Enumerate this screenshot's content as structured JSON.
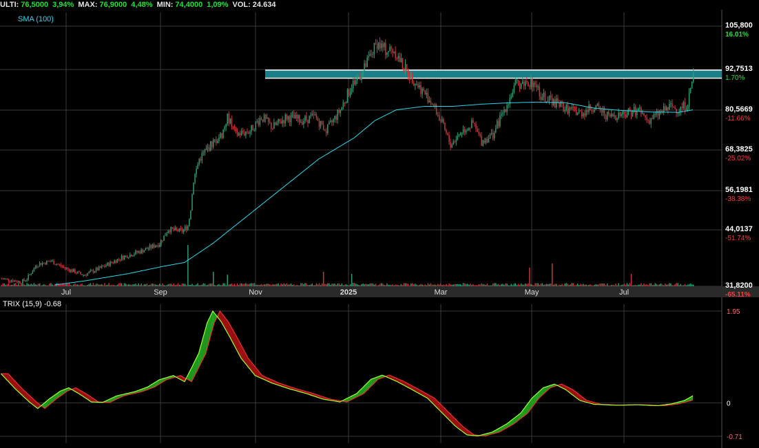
{
  "header": {
    "ulti_label": "ULTI:",
    "ulti_value": "76,5000",
    "ulti_pct": "3,94%",
    "max_label": "MAX:",
    "max_value": "76,9000",
    "max_pct": "4,48%",
    "min_label": "MIN:",
    "min_value": "74,4000",
    "min_pct": "1,09%",
    "vol_label": "VOL:",
    "vol_value": "24.634"
  },
  "sma_label": "SMA (100)",
  "trix_label": "TRIX (15,9) -0.68",
  "colors": {
    "up": "#2f9a73",
    "down": "#c8343f",
    "sma": "#2fd9e8",
    "band": "#1a7f86",
    "trix_fast": "#9cff3c",
    "trix_slow": "#e83030",
    "grid": "#3a3a3a",
    "pct_pos": "#22e03a",
    "pct_neg": "#ff3b3b"
  },
  "chart_data": [
    {
      "type": "candlestick",
      "x_labels": [
        "Jul",
        "Sep",
        "Nov",
        "2025",
        "Mar",
        "May",
        "Jul"
      ],
      "y_ticks": [
        {
          "value": "105,800",
          "pct": "16.01%"
        },
        {
          "value": "92,7513",
          "pct": "1.70%"
        },
        {
          "value": "80,5669",
          "pct": "-11.66%"
        },
        {
          "value": "68,3825",
          "pct": "-25.02%"
        },
        {
          "value": "56,1981",
          "pct": "-38.38%"
        },
        {
          "value": "44,0137",
          "pct": "-51.74%"
        },
        {
          "value": "31,8200",
          "pct": "-65.11%"
        }
      ],
      "ylim": [
        31.82,
        105.8
      ],
      "resistance_band": [
        91.0,
        93.3
      ],
      "price_anchors": [
        [
          0,
          34
        ],
        [
          8,
          33.5
        ],
        [
          14,
          33
        ],
        [
          18,
          34
        ],
        [
          25,
          38
        ],
        [
          35,
          39
        ],
        [
          45,
          37
        ],
        [
          58,
          35
        ],
        [
          70,
          37
        ],
        [
          85,
          40
        ],
        [
          100,
          42
        ],
        [
          112,
          44
        ],
        [
          118,
          48
        ],
        [
          128,
          47.5
        ],
        [
          132,
          49
        ],
        [
          134,
          54
        ],
        [
          136,
          62
        ],
        [
          140,
          68
        ],
        [
          148,
          72
        ],
        [
          156,
          75
        ],
        [
          160,
          80
        ],
        [
          166,
          75
        ],
        [
          176,
          76
        ],
        [
          184,
          80
        ],
        [
          192,
          77
        ],
        [
          202,
          80
        ],
        [
          212,
          79
        ],
        [
          222,
          80
        ],
        [
          230,
          76
        ],
        [
          240,
          82
        ],
        [
          248,
          89
        ],
        [
          256,
          93
        ],
        [
          262,
          98
        ],
        [
          266,
          101
        ],
        [
          272,
          99
        ],
        [
          278,
          99
        ],
        [
          285,
          94
        ],
        [
          295,
          89
        ],
        [
          305,
          84
        ],
        [
          312,
          78
        ],
        [
          318,
          72
        ],
        [
          326,
          76
        ],
        [
          334,
          78
        ],
        [
          340,
          73
        ],
        [
          348,
          75
        ],
        [
          356,
          82
        ],
        [
          364,
          89
        ],
        [
          372,
          90
        ],
        [
          378,
          90
        ],
        [
          382,
          86
        ],
        [
          392,
          84
        ],
        [
          402,
          82
        ],
        [
          410,
          81
        ],
        [
          420,
          83
        ],
        [
          430,
          80
        ],
        [
          440,
          81
        ],
        [
          450,
          82
        ],
        [
          458,
          79
        ],
        [
          466,
          81
        ],
        [
          474,
          83
        ],
        [
          480,
          82
        ],
        [
          486,
          84
        ],
        [
          490,
          92
        ]
      ],
      "sma_anchors": [
        [
          38,
          32.2
        ],
        [
          60,
          33.4
        ],
        [
          90,
          35.4
        ],
        [
          115,
          37.5
        ],
        [
          130,
          38.6
        ],
        [
          150,
          44
        ],
        [
          175,
          52
        ],
        [
          200,
          60
        ],
        [
          225,
          68
        ],
        [
          250,
          74
        ],
        [
          265,
          79
        ],
        [
          280,
          82
        ],
        [
          300,
          83
        ],
        [
          320,
          83
        ],
        [
          340,
          83.6
        ],
        [
          360,
          84
        ],
        [
          380,
          84.2
        ],
        [
          400,
          84
        ],
        [
          420,
          82.5
        ],
        [
          440,
          81.8
        ],
        [
          460,
          81.4
        ],
        [
          480,
          81.3
        ],
        [
          490,
          82
        ]
      ],
      "volume_spike_bars": [
        [
          132,
          1.0
        ],
        [
          150,
          0.35
        ],
        [
          160,
          0.28
        ],
        [
          228,
          0.35
        ],
        [
          248,
          0.3
        ],
        [
          374,
          0.45
        ],
        [
          390,
          0.55
        ],
        [
          446,
          0.3
        ]
      ]
    },
    {
      "type": "line",
      "name": "TRIX (15,9)",
      "y_ticks": [
        {
          "value": "1.95"
        },
        {
          "value": "0"
        },
        {
          "value": "-0.71"
        }
      ],
      "ylim": [
        -0.71,
        1.95
      ],
      "trix_anchors": [
        [
          0,
          0.62
        ],
        [
          10,
          0.3
        ],
        [
          20,
          0.02
        ],
        [
          26,
          -0.12
        ],
        [
          34,
          0.08
        ],
        [
          42,
          0.25
        ],
        [
          48,
          0.32
        ],
        [
          56,
          0.18
        ],
        [
          64,
          0.02
        ],
        [
          72,
          0.01
        ],
        [
          82,
          0.15
        ],
        [
          95,
          0.24
        ],
        [
          104,
          0.34
        ],
        [
          112,
          0.49
        ],
        [
          122,
          0.58
        ],
        [
          130,
          0.45
        ],
        [
          140,
          1.05
        ],
        [
          146,
          1.7
        ],
        [
          150,
          1.95
        ],
        [
          156,
          1.72
        ],
        [
          162,
          1.4
        ],
        [
          170,
          0.95
        ],
        [
          180,
          0.58
        ],
        [
          192,
          0.42
        ],
        [
          204,
          0.3
        ],
        [
          216,
          0.2
        ],
        [
          228,
          0.08
        ],
        [
          240,
          0.02
        ],
        [
          252,
          0.2
        ],
        [
          262,
          0.5
        ],
        [
          270,
          0.59
        ],
        [
          280,
          0.46
        ],
        [
          290,
          0.3
        ],
        [
          302,
          0.1
        ],
        [
          312,
          -0.2
        ],
        [
          322,
          -0.5
        ],
        [
          330,
          -0.68
        ],
        [
          338,
          -0.7
        ],
        [
          348,
          -0.62
        ],
        [
          358,
          -0.45
        ],
        [
          368,
          -0.22
        ],
        [
          376,
          0.1
        ],
        [
          384,
          0.32
        ],
        [
          392,
          0.4
        ],
        [
          400,
          0.28
        ],
        [
          410,
          0.05
        ],
        [
          420,
          -0.03
        ],
        [
          435,
          -0.05
        ],
        [
          450,
          -0.04
        ],
        [
          465,
          -0.06
        ],
        [
          475,
          -0.02
        ],
        [
          484,
          0.05
        ],
        [
          490,
          0.15
        ]
      ],
      "signal_lag": 5
    }
  ]
}
